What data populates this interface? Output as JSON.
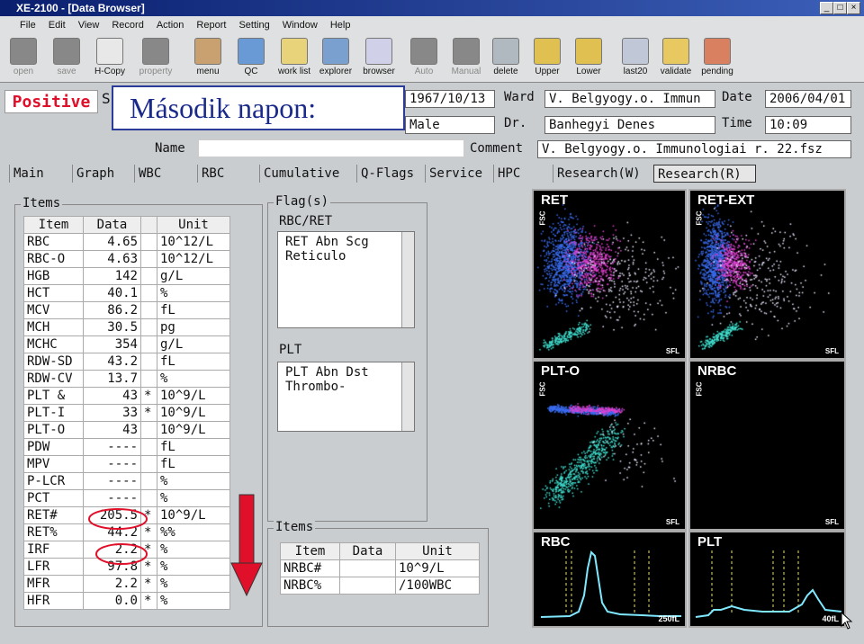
{
  "window": {
    "title": "XE-2100 - [Data Browser]",
    "controls": [
      "_",
      "□",
      "×"
    ]
  },
  "menu": [
    "File",
    "Edit",
    "View",
    "Record",
    "Action",
    "Report",
    "Setting",
    "Window",
    "Help"
  ],
  "toolbar": [
    {
      "label": "open",
      "icon": "folder-open-icon",
      "enabled": false
    },
    {
      "label": "save",
      "icon": "floppy-icon",
      "enabled": false
    },
    {
      "label": "H-Copy",
      "icon": "printer-icon",
      "enabled": true
    },
    {
      "label": "property",
      "icon": "property-icon",
      "enabled": false
    },
    {
      "label": "menu",
      "icon": "menu-icon",
      "enabled": true
    },
    {
      "label": "QC",
      "icon": "qc-globe-icon",
      "enabled": true
    },
    {
      "label": "work list",
      "icon": "work-list-icon",
      "enabled": true
    },
    {
      "label": "explorer",
      "icon": "explorer-icon",
      "enabled": true
    },
    {
      "label": "browser",
      "icon": "browser-icon",
      "enabled": true
    },
    {
      "label": "Auto",
      "icon": "auto-icon",
      "enabled": false
    },
    {
      "label": "Manual",
      "icon": "manual-icon",
      "enabled": false
    },
    {
      "label": "delete",
      "icon": "trash-icon",
      "enabled": true
    },
    {
      "label": "Upper",
      "icon": "upper-icon",
      "enabled": true
    },
    {
      "label": "Lower",
      "icon": "lower-icon",
      "enabled": true
    },
    {
      "label": "last20",
      "icon": "last20-icon",
      "enabled": true
    },
    {
      "label": "validate",
      "icon": "validate-icon",
      "enabled": true
    },
    {
      "label": "pending",
      "icon": "pending-icon",
      "enabled": true
    }
  ],
  "status": {
    "positive": "Positive",
    "s_letter": "S"
  },
  "overlay_text": "Második napon:",
  "patient": {
    "birth": "1967/10/13",
    "sex": "Male",
    "ward_label": "Ward",
    "ward": "V. Belgyogy.o. Immun",
    "dr_label": "Dr.",
    "dr": "Banhegyi Denes",
    "date_label": "Date",
    "date": "2006/04/01",
    "time_label": "Time",
    "time": "10:09",
    "name_label": "Name",
    "name": "",
    "comment_label": "Comment",
    "comment": "V. Belgyogy.o. Immunologiai r. 22.fsz"
  },
  "tabs": [
    "Main",
    "Graph",
    "WBC",
    "RBC",
    "Cumulative",
    "Q-Flags",
    "Service",
    "HPC",
    "Research(W)",
    "Research(R)"
  ],
  "items_title": "Items",
  "items_headers": [
    "Item",
    "Data",
    "",
    "Unit"
  ],
  "items": [
    [
      "RBC",
      "4.65",
      "",
      "10^12/L"
    ],
    [
      "RBC-O",
      "4.63",
      "",
      "10^12/L"
    ],
    [
      "HGB",
      "142",
      "",
      "g/L"
    ],
    [
      "HCT",
      "40.1",
      "",
      "%"
    ],
    [
      "MCV",
      "86.2",
      "",
      "fL"
    ],
    [
      "MCH",
      "30.5",
      "",
      "pg"
    ],
    [
      "MCHC",
      "354",
      "",
      "g/L"
    ],
    [
      "RDW-SD",
      "43.2",
      "",
      "fL"
    ],
    [
      "RDW-CV",
      "13.7",
      "",
      "%"
    ],
    [
      "PLT  &",
      "43",
      "*",
      "10^9/L"
    ],
    [
      "PLT-I",
      "33",
      "*",
      "10^9/L"
    ],
    [
      "PLT-O",
      "43",
      "",
      "10^9/L"
    ],
    [
      "PDW",
      "----",
      "",
      "fL"
    ],
    [
      "MPV",
      "----",
      "",
      "fL"
    ],
    [
      "P-LCR",
      "----",
      "",
      "%"
    ],
    [
      "PCT",
      "----",
      "",
      "%"
    ],
    [
      "RET#",
      "205.5",
      "*",
      "10^9/L"
    ],
    [
      "RET%",
      "44.2",
      "*",
      "%%"
    ],
    [
      "IRF",
      "2.2",
      "*",
      "%"
    ],
    [
      "LFR",
      "97.8",
      "*",
      "%"
    ],
    [
      "MFR",
      "2.2",
      "*",
      "%"
    ],
    [
      "HFR",
      "0.0",
      "*",
      "%"
    ]
  ],
  "flags": {
    "title": "Flag(s)",
    "rbc_ret_label": "RBC/RET",
    "rbc_ret": [
      "RET Abn Scg",
      "Reticulo"
    ],
    "plt_label": "PLT",
    "plt": [
      "PLT Abn Dst",
      "Thrombo-"
    ]
  },
  "items2": {
    "title": "Items",
    "headers": [
      "Item",
      "Data",
      "Unit"
    ],
    "rows": [
      [
        "NRBC#",
        "",
        "10^9/L"
      ],
      [
        "NRBC%",
        "",
        "/100WBC"
      ]
    ]
  },
  "plots": [
    {
      "name": "RET",
      "x": "SFL",
      "y": "FSC"
    },
    {
      "name": "RET-EXT",
      "x": "SFL",
      "y": "FSC"
    },
    {
      "name": "PLT-O",
      "x": "SFL",
      "y": "FSC"
    },
    {
      "name": "NRBC",
      "x": "SFL",
      "y": "FSC"
    },
    {
      "name": "RBC",
      "x": "250fL"
    },
    {
      "name": "PLT",
      "x": "40fL"
    }
  ],
  "colors": {
    "positive": "#e0102a",
    "overlay_border": "#2a3b9a",
    "annotation": "#e0102a",
    "curve": "#7fe8ff"
  }
}
